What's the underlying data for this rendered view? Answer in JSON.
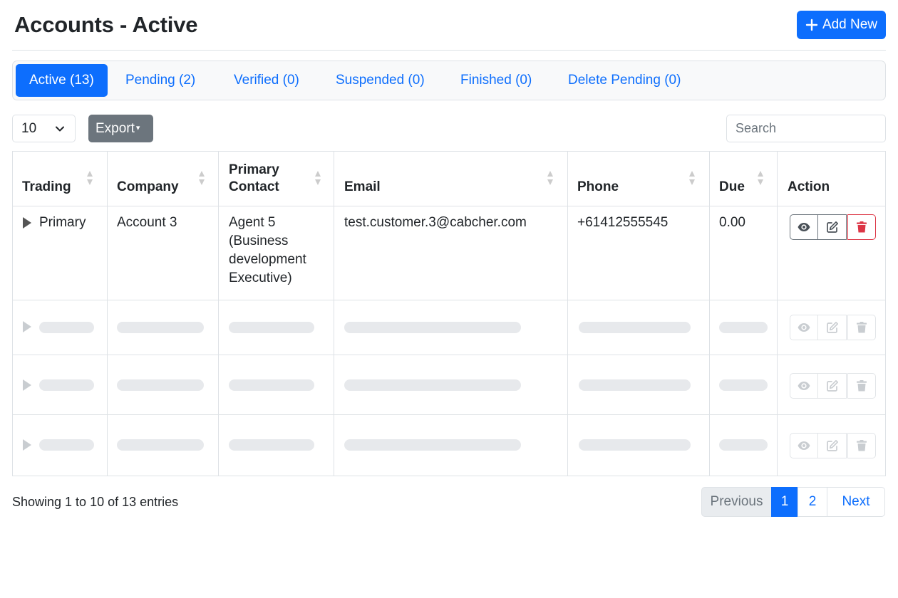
{
  "header": {
    "title": "Accounts - Active",
    "add_new_label": "Add New"
  },
  "tabs": [
    {
      "label": "Active (13)",
      "active": true
    },
    {
      "label": "Pending (2)",
      "active": false
    },
    {
      "label": "Verified (0)",
      "active": false
    },
    {
      "label": "Suspended (0)",
      "active": false
    },
    {
      "label": "Finished (0)",
      "active": false
    },
    {
      "label": "Delete Pending (0)",
      "active": false
    }
  ],
  "controls": {
    "page_length": "10",
    "export_label": "Export",
    "search_placeholder": "Search"
  },
  "table": {
    "columns": [
      "Trading",
      "Company",
      "Primary",
      "Contact",
      "Email",
      "Phone",
      "Due",
      "Action"
    ],
    "rows": [
      {
        "trading": "Primary",
        "company": "Account 3",
        "contact_lines": [
          "Agent 5",
          "(Business",
          "development",
          "Executive)"
        ],
        "email": "test.customer.3@cabcher.com",
        "phone": "+61412555545",
        "due": "0.00"
      }
    ]
  },
  "footer": {
    "info": "Showing 1 to 10 of 13 entries",
    "pagination": {
      "previous": "Previous",
      "page1": "1",
      "page2": "2",
      "next": "Next"
    }
  },
  "colors": {
    "primary": "#0d6efd",
    "danger": "#dc3545",
    "secondary": "#6c757d"
  }
}
